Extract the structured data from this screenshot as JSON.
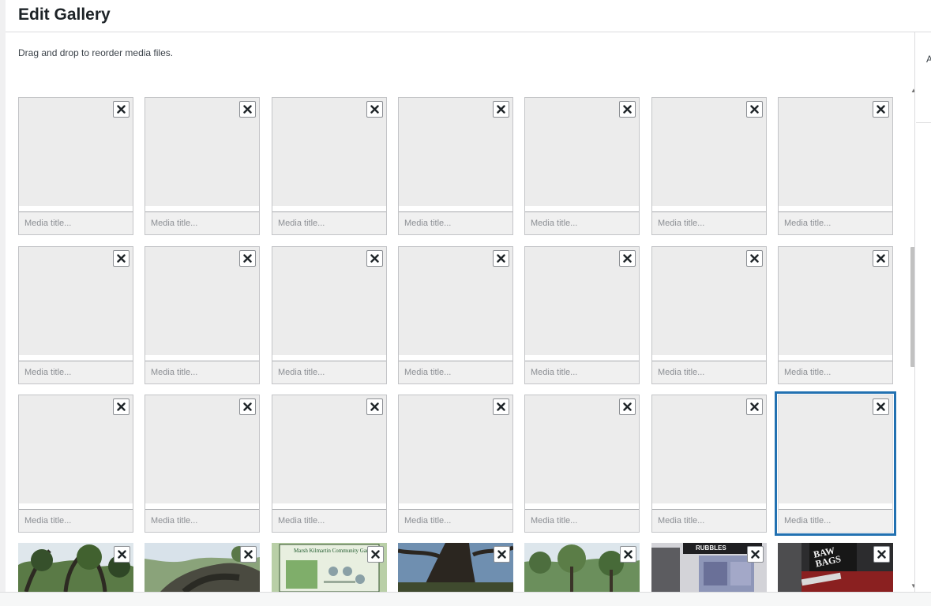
{
  "modal": {
    "title": "Edit Gallery",
    "instructions": "Drag and drop to reorder media files.",
    "sidebar_label": "A"
  },
  "media_item": {
    "title_placeholder": "Media title...",
    "remove_icon": "close-icon"
  },
  "grid": {
    "columns": 7,
    "placeholder_rows": 3,
    "selected_index": 20,
    "photo_row": [
      {
        "label": ""
      },
      {
        "label": ""
      },
      {
        "label": "Marsh Kilmartin Community Garden",
        "board": true
      },
      {
        "label": ""
      },
      {
        "label": ""
      },
      {
        "label": "RUBBLES",
        "shop": true
      },
      {
        "label": "BAW BAGS",
        "sign": true
      }
    ]
  },
  "colors": {
    "accent": "#2271b1",
    "placeholder_bg": "#ececec",
    "border": "#c3c4c7"
  }
}
